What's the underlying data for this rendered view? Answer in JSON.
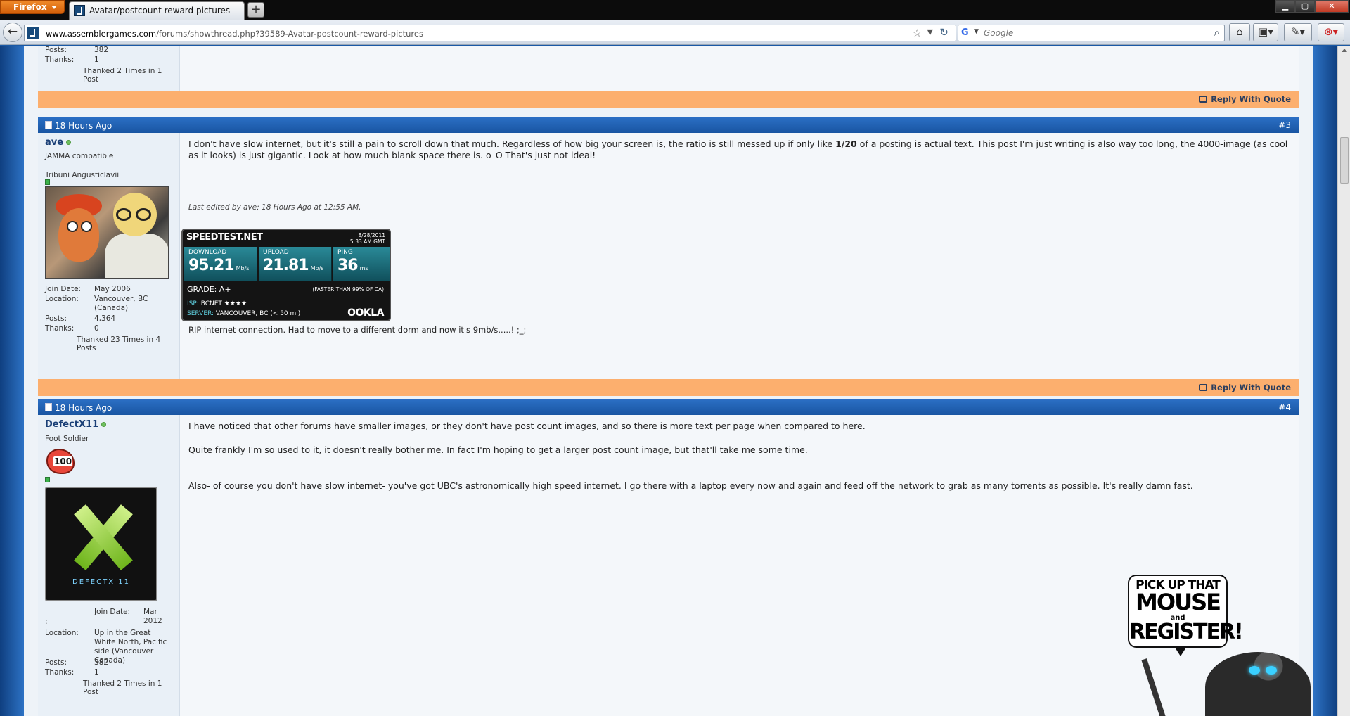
{
  "browser": {
    "app_button": "Firefox",
    "tab_title": "Avatar/postcount reward pictures",
    "new_tab_label": "+",
    "url_domain": "www.assemblergames.com",
    "url_path": "/forums/showthread.php?39589-Avatar-postcount-reward-pictures",
    "search_engine_icon": "google-icon",
    "search_placeholder": "Google",
    "window_controls": [
      "minimize",
      "maximize",
      "close"
    ]
  },
  "posts": [
    {
      "partial": true,
      "posts_label": "Posts:",
      "posts_value": "382",
      "thanks_label": "Thanks:",
      "thanks_value": "1",
      "thanked": "Thanked 2 Times in 1 Post",
      "reply_label": "Reply With Quote"
    },
    {
      "date": "18 Hours Ago",
      "number": "#3",
      "username": "ave",
      "user_title": "JAMMA compatible",
      "rank_title": "Tribuni Angusticlavii",
      "info": [
        {
          "k": "Join Date:",
          "v": "May 2006"
        },
        {
          "k": "Location:",
          "v": "Vancouver, BC (Canada)"
        },
        {
          "k": "Posts:",
          "v": "4,364"
        },
        {
          "k": "Thanks:",
          "v": "0"
        }
      ],
      "thanked": "Thanked 23 Times in 4 Posts",
      "message_before": "I don't have slow internet, but it's still a pain to scroll down that much. Regardless of how big your screen is, the ratio is still messed up if only like ",
      "message_bold": "1/20",
      "message_after": " of a posting is actual text. This post I'm just writing is also way too long, the 4000-image (as cool as it looks) is just gigantic. Look at how much blank space there is. o_O That's just not ideal!",
      "last_edited": "Last edited by ave; 18 Hours Ago at 12:55 AM.",
      "signature_text": "RIP internet connection. Had to move to a different dorm and now it's 9mb/s.....! ;_;",
      "reply_label": "Reply With Quote"
    },
    {
      "date": "18 Hours Ago",
      "number": "#4",
      "username": "DefectX11",
      "user_title": "Foot Soldier",
      "postcount_badge": "100",
      "avatar_text": "DEFECTX 11",
      "join_label": "Join Date:",
      "join_value": "Mar 2012",
      "join_colon": ":",
      "info": [
        {
          "k": "Location:",
          "v": "Up in the Great White North, Pacific side (Vancouver Canada)"
        },
        {
          "k": "Posts:",
          "v": "382"
        },
        {
          "k": "Thanks:",
          "v": "1"
        }
      ],
      "thanked": "Thanked 2 Times in 1 Post",
      "paragraphs": [
        "I have noticed that other forums have smaller images, or they don't have post count images, and so there is more text per page when compared to here.",
        "Quite frankly I'm so used to it, it doesn't really bother me. In fact I'm hoping to get a larger post count image, but that'll take me some time.",
        "Also- of course you don't have slow internet- you've got UBC's astronomically high speed internet. I go there with a laptop every now and again and feed off the network to grab as many torrents as possible. It's really damn fast."
      ]
    }
  ],
  "speedtest": {
    "brand": "SPEEDTEST.NET",
    "date": "8/28/2011",
    "time": "5:33 AM GMT",
    "download_label": "DOWNLOAD",
    "download_value": "95.21",
    "download_unit": "Mb/s",
    "upload_label": "UPLOAD",
    "upload_value": "21.81",
    "upload_unit": "Mb/s",
    "ping_label": "PING",
    "ping_value": "36",
    "ping_unit": "ms",
    "grade": "GRADE: A+",
    "faster": "(FASTER THAN 99% OF CA)",
    "isp_label": "ISP:",
    "isp_value": "BCNET ★★★★",
    "server_label": "SERVER:",
    "server_value": "VANCOUVER, BC (< 50 mi)",
    "ookla": "OOKLA"
  },
  "promo": {
    "line1": "PICK UP THAT",
    "line2": "MOUSE",
    "line3": "and",
    "line4": "REGISTER!"
  }
}
